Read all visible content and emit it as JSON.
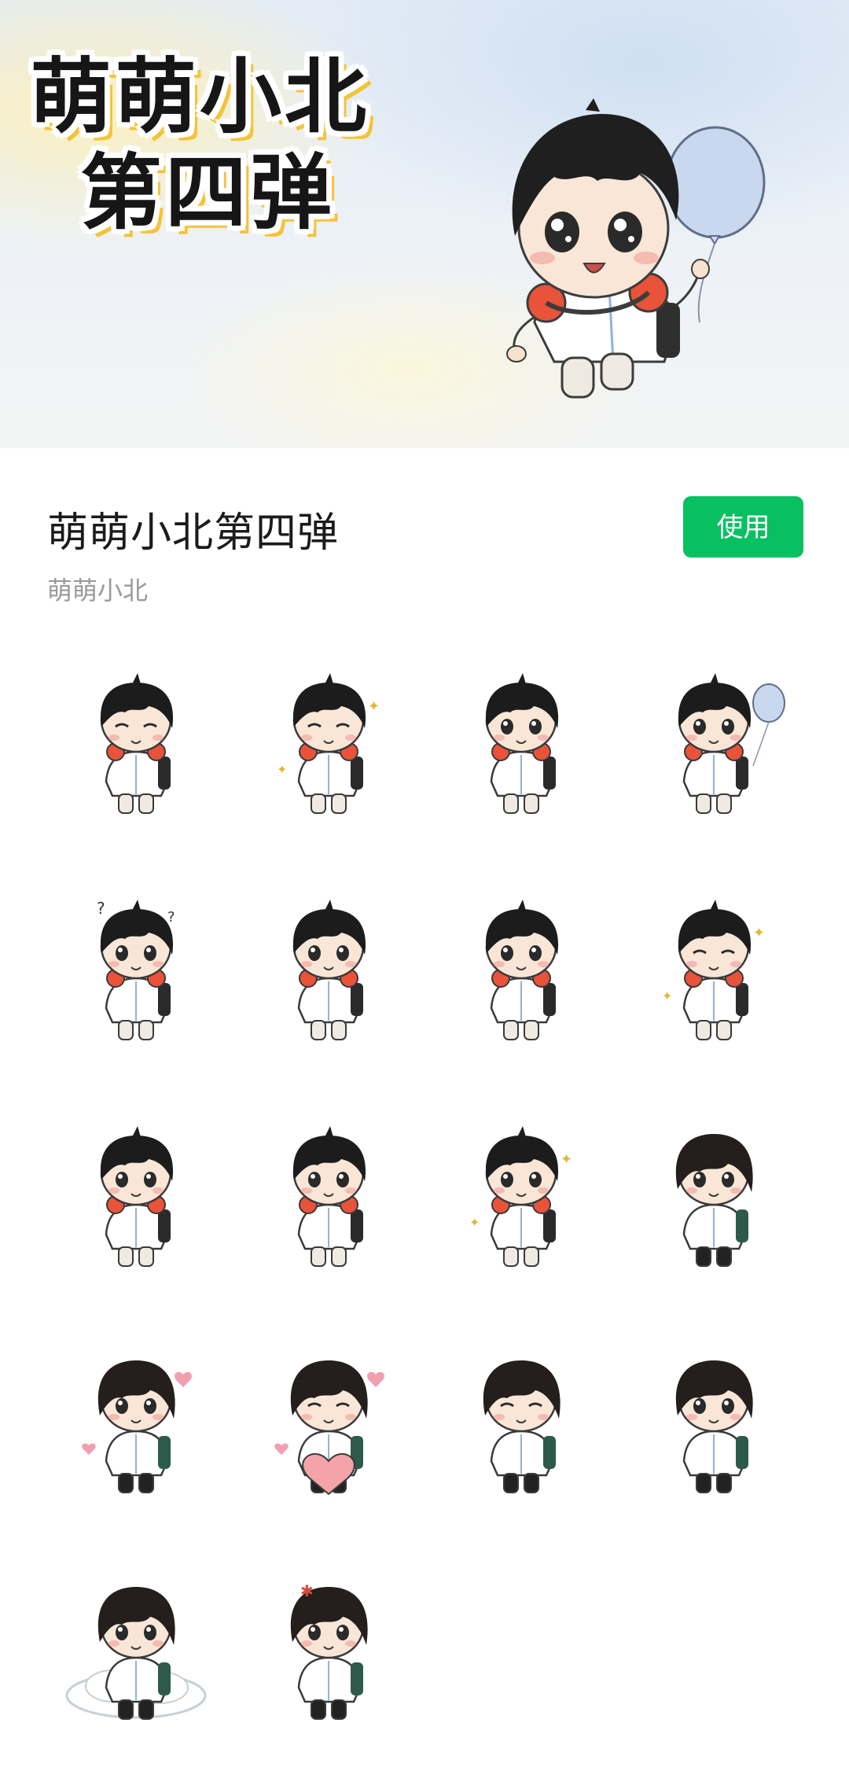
{
  "banner": {
    "title_line1": "萌萌小北",
    "title_line2": "第四弹"
  },
  "pack": {
    "title": "萌萌小北第四弹",
    "author": "萌萌小北",
    "use_label": "使用"
  },
  "colors": {
    "accent": "#07c160",
    "banner_title_shadow": "#f3c43b"
  },
  "stickers": [
    {
      "name": "sleepy-sitting"
    },
    {
      "name": "smile-sparkle"
    },
    {
      "name": "shy-sweat"
    },
    {
      "name": "balloon-jump"
    },
    {
      "name": "question-marks"
    },
    {
      "name": "waving-hello"
    },
    {
      "name": "arms-crossed-huff"
    },
    {
      "name": "cheering-stars"
    },
    {
      "name": "crying-trembling"
    },
    {
      "name": "hands-cover-face"
    },
    {
      "name": "sparkle-eyes"
    },
    {
      "name": "hugging-knees"
    },
    {
      "name": "wink-hearts"
    },
    {
      "name": "holding-heart"
    },
    {
      "name": "yawning-tired"
    },
    {
      "name": "blushing-cover-face"
    },
    {
      "name": "lying-on-cloud"
    },
    {
      "name": "angry-vein"
    }
  ]
}
